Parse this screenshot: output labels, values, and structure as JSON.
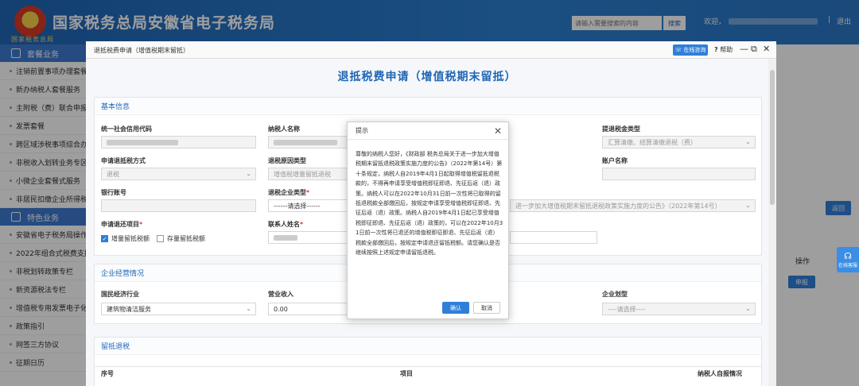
{
  "header": {
    "logo_sub": "国家税务总局",
    "title": "国家税务总局安徽省电子税务局",
    "search_placeholder": "请输入需要搜索的内容",
    "search_btn": "搜索",
    "welcome": "欢迎，",
    "divider": "|",
    "logout": "退出"
  },
  "sidebar": {
    "sections": [
      {
        "label": "套餐业务",
        "icon": "user-icon"
      },
      {
        "label": "特色业务",
        "icon": "grid-icon"
      }
    ],
    "items_a": [
      "注销前置事项办理套餐",
      "新办纳税人套餐服务",
      "主附税（费）联合申报",
      "发票套餐",
      "跨区域涉税事项综合办理",
      "非税收入划转业务专区",
      "小微企业套餐式服务",
      "非居民扣缴企业所得税"
    ],
    "items_b": [
      "安徽省电子税务局操作手册",
      "2022年组合式税费支持政策",
      "非税划转政策专栏",
      "新资源税法专栏",
      "增值税专用发票电子化",
      "政策指引",
      "网签三方协议",
      "征期日历"
    ]
  },
  "background": {
    "back_btn": "返回",
    "op_header": "操作",
    "apply_btn": "申报",
    "float_service": "在线客服"
  },
  "modal": {
    "title": "退抵税费申请（增值税期末留抵）",
    "online_btn": "在线咨询",
    "help": "帮助",
    "page_title": "退抵税费申请（增值税期末留抵）",
    "basic": {
      "header": "基本信息",
      "uscc_label": "统一社会信用代码",
      "taxpayer_name_label": "纳税人名称",
      "refund_type_label": "提退税金类型",
      "refund_type_value": "汇算清缴、结算清缴退税（费）",
      "method_label": "申请退抵税方式",
      "method_value": "退税",
      "reason_label": "退税原因类型",
      "reason_value": "增值税增量留抵退税",
      "account_name_label": "账户名称",
      "bank_account_label": "银行账号",
      "refund_company_type_label": "退税企业类型",
      "refund_company_type_value": "------请选择------",
      "policy_value": "进一步加大增值税期末留抵退税政策实施力度的公告》（2022年第14号）",
      "refund_items_label": "申请退还项目",
      "item_incremental": "增量留抵税额",
      "item_stock": "存量留抵税额",
      "contact_label": "联系人姓名"
    },
    "business": {
      "header": "企业经营情况",
      "industry_label": "国民经济行业",
      "industry_value": "建筑物清洁服务",
      "revenue_label": "营业收入",
      "revenue_value": "0.00",
      "scale_label": "企业划型",
      "scale_value": "----请选择----"
    },
    "credit": {
      "header": "留抵退税",
      "col_no": "序号",
      "col_item": "项目",
      "col_self": "纳税人自报情况"
    }
  },
  "alert": {
    "title": "提示",
    "message": "尊敬的纳税人您好，《财政部 税务总局关于进一步加大增值税期末留抵退税政策实施力度的公告》（2022年第14号）第十条规定，纳税人自2019年4月1日起取得增值税留抵退税款的，不得再申请享受增值税即征即退、先征后返（退）政策。纳税人可以在2022年10月31日前一次性将已取得的留抵退税款全部缴回后，按规定申请享受增值税即征即退、先征后返（退）政策。纳税人自2019年4月1日起已享受增值税即征即退、先征后返（退）政策的，可以在2022年10月31日前一次性将已退还的增值税即征即退、先征后返（退）税款全部缴回后，按规定申请退还留抵税额。请您确认是否继续按照上述规定申请留抵退税。",
    "ok": "确认",
    "cancel": "取消"
  }
}
